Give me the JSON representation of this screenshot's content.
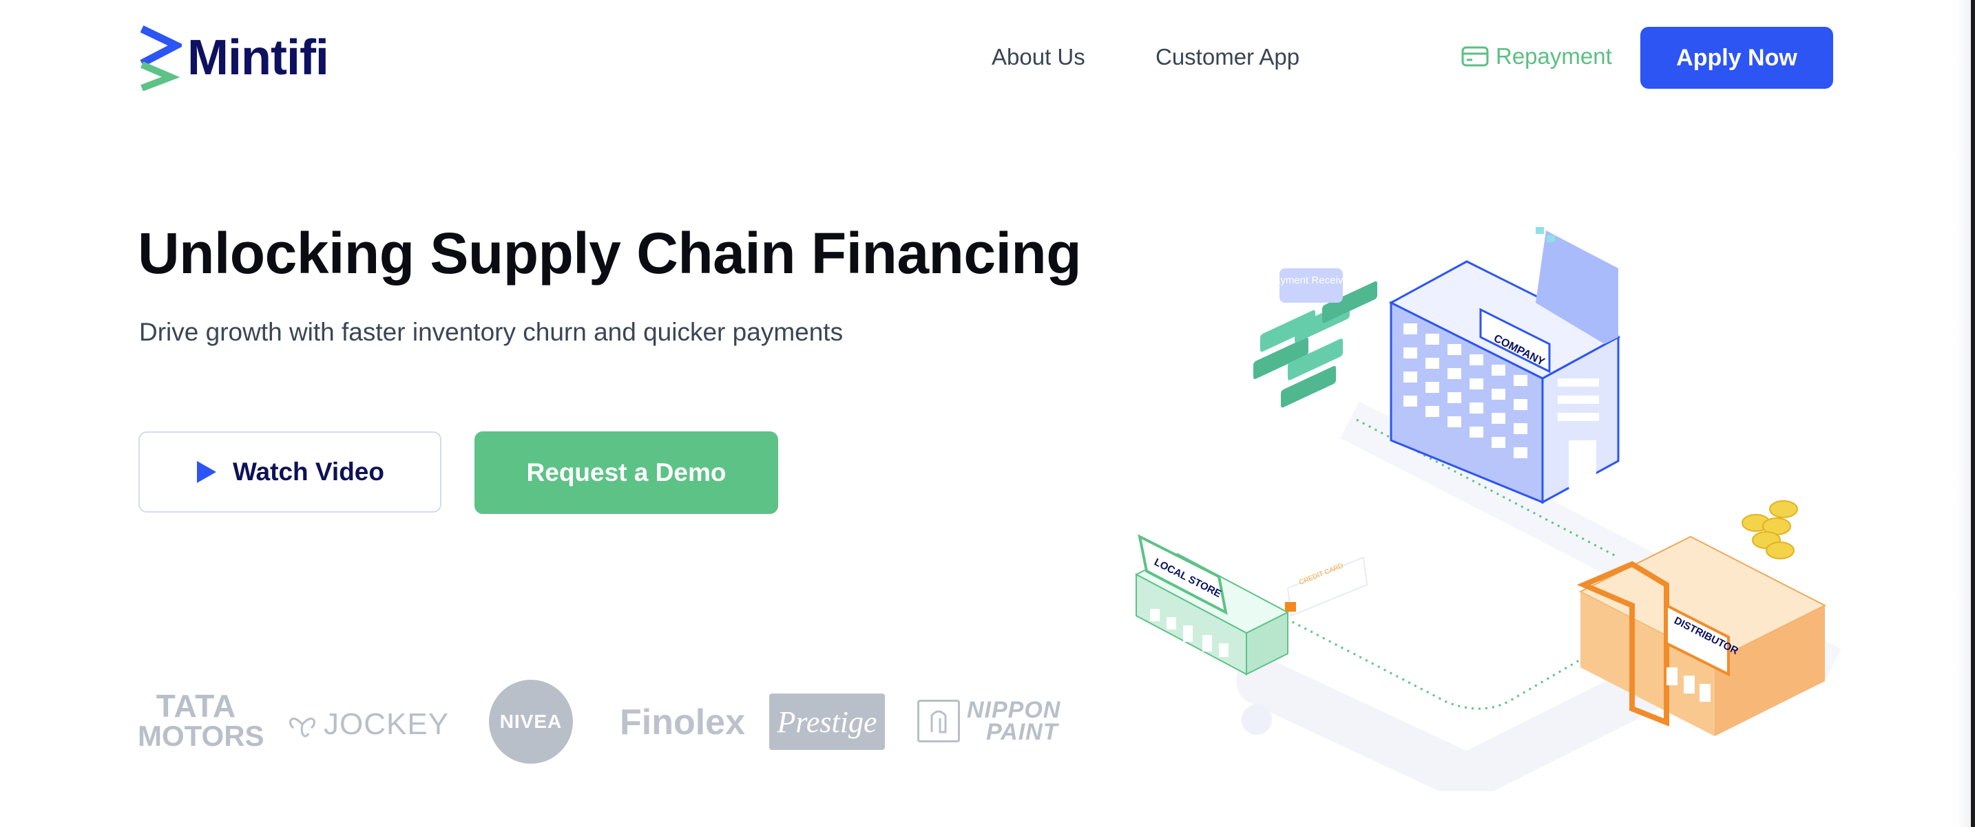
{
  "brand": {
    "name": "Mintifi"
  },
  "nav": {
    "about": "About Us",
    "customer_app": "Customer App",
    "repayment": "Repayment",
    "apply": "Apply Now"
  },
  "hero": {
    "title": "Unlocking Supply Chain Financing",
    "subtitle": "Drive growth with faster inventory churn and quicker payments",
    "watch_video": "Watch Video",
    "request_demo": "Request a Demo"
  },
  "illustration": {
    "company": "COMPANY",
    "local_store": "LOCAL STORE",
    "distributor": "DISTRIBUTOR",
    "payment_received": "Payment Received",
    "credit_card": "CREDIT CARD"
  },
  "clients": {
    "tata_line1": "TATA",
    "tata_line2": "MOTORS",
    "jockey": "JOCKEY",
    "nivea": "NIVEA",
    "finolex": "Finolex",
    "prestige": "Prestige",
    "nippon_line1": "NIPPON",
    "nippon_line2": "PAINT"
  },
  "colors": {
    "primary_blue": "#2c55f4",
    "demo_green": "#5dc286",
    "title_dark": "#0b0b12",
    "logo_navy": "#0d1160"
  }
}
